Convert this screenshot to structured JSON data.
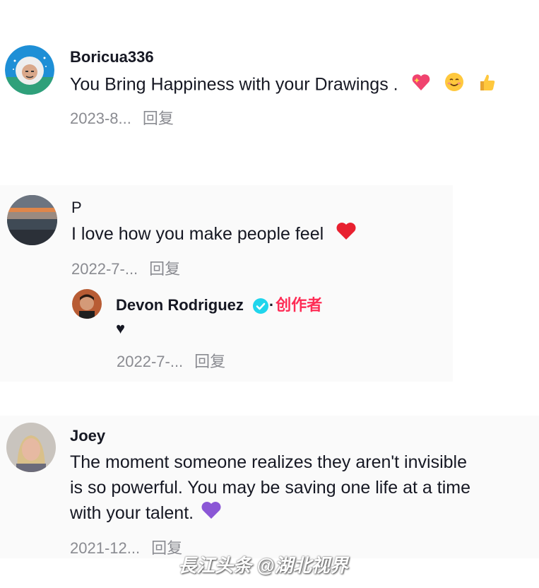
{
  "comments": [
    {
      "username": "Boricua336",
      "text": "You Bring Happiness with your Drawings .",
      "emojis": [
        "sparkling-heart",
        "smiling-face",
        "thumbs-up"
      ],
      "date": "2023-8...",
      "reply_label": "回复"
    },
    {
      "username": "P",
      "text": "I love how you make people feel",
      "emojis": [
        "red-heart"
      ],
      "date": "2022-7-...",
      "reply_label": "回复",
      "replies": [
        {
          "username": "Devon Rodriguez",
          "verified": true,
          "badge_sep": "·",
          "badge": "创作者",
          "text": "♥",
          "date": "2022-7-...",
          "reply_label": "回复"
        }
      ]
    },
    {
      "username": "Joey",
      "text_lines": [
        "The moment someone realizes they aren't invisible",
        "is so powerful. You may be saving one life at a time",
        "with your talent."
      ],
      "emojis": [
        "purple-heart"
      ],
      "date": "2021-12...",
      "reply_label": "回复"
    }
  ],
  "watermark": "長江头条 @湖北视界",
  "colors": {
    "text": "#161823",
    "meta": "#8a8b91",
    "creator_badge": "#fe2c55",
    "verified": "#20d5ec"
  }
}
